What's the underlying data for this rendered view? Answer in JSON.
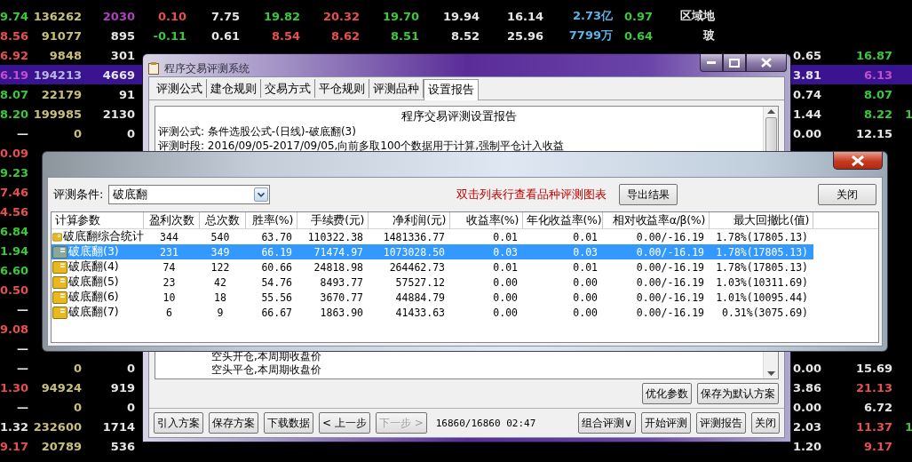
{
  "quotes": [
    {
      "selected": false,
      "left": [
        {
          "text": "9.74",
          "color": "#3cc83c"
        },
        {
          "text": "136262",
          "color": "#c8c07a"
        },
        {
          "text": "2030",
          "color": "#b040c0"
        }
      ],
      "mid": [
        {
          "text": "0.10",
          "color": "#e65050"
        },
        {
          "text": "7.75",
          "color": "#e6e6e6"
        },
        {
          "text": "19.82",
          "color": "#3cc83c"
        },
        {
          "text": "20.32",
          "color": "#e65050"
        },
        {
          "text": "19.70",
          "color": "#3cc83c"
        },
        {
          "text": "19.94",
          "color": "#e6e6e6"
        },
        {
          "text": "16.14",
          "color": "#e6e6e6"
        },
        {
          "text": "2.73亿",
          "color": "#5ab4e6"
        },
        {
          "text": "0.97",
          "color": "#3cc83c"
        },
        {
          "text": "区域地",
          "color": "#e6e6e6"
        }
      ]
    },
    {
      "selected": false,
      "left": [
        {
          "text": "8.56",
          "color": "#e65050"
        },
        {
          "text": "91077",
          "color": "#c8c07a"
        },
        {
          "text": "895",
          "color": "#e6e6e6"
        }
      ],
      "mid": [
        {
          "text": "-0.11",
          "color": "#3cc83c"
        },
        {
          "text": "0.61",
          "color": "#e6e6e6"
        },
        {
          "text": "8.54",
          "color": "#e65050"
        },
        {
          "text": "8.62",
          "color": "#e65050"
        },
        {
          "text": "8.51",
          "color": "#3cc83c"
        },
        {
          "text": "8.52",
          "color": "#e6e6e6"
        },
        {
          "text": "25.96",
          "color": "#e6e6e6"
        },
        {
          "text": "7799万",
          "color": "#5ab4e6"
        },
        {
          "text": "0.64",
          "color": "#3cc83c"
        },
        {
          "text": "玻",
          "color": "#e6e6e6"
        }
      ]
    },
    {
      "selected": false,
      "left": [
        {
          "text": "6.92",
          "color": "#e65050"
        },
        {
          "text": "9848",
          "color": "#c8c07a"
        },
        {
          "text": "301",
          "color": "#e6e6e6"
        }
      ],
      "right": [
        {
          "text": "0.65",
          "color": "#e6e6e6"
        },
        {
          "text": "16.87",
          "color": "#3cc83c"
        }
      ]
    },
    {
      "selected": true,
      "left": [
        {
          "text": "6.19",
          "color": "#c050d0"
        },
        {
          "text": "194213",
          "color": "#b8b8e0"
        },
        {
          "text": "4669",
          "color": "#e6e6e6"
        }
      ],
      "right": [
        {
          "text": "3.81",
          "color": "#e6e6e6"
        },
        {
          "text": "6.13",
          "color": "#c050d0"
        }
      ]
    },
    {
      "selected": false,
      "left": [
        {
          "text": "8.07",
          "color": "#3cc83c"
        },
        {
          "text": "22179",
          "color": "#c8c07a"
        },
        {
          "text": "91",
          "color": "#e6e6e6"
        }
      ],
      "right": [
        {
          "text": "0.74",
          "color": "#e6e6e6"
        },
        {
          "text": "8.07",
          "color": "#3cc83c"
        }
      ]
    },
    {
      "selected": false,
      "left": [
        {
          "text": "8.20",
          "color": "#3cc83c"
        },
        {
          "text": "199985",
          "color": "#c8c07a"
        },
        {
          "text": "2130",
          "color": "#e6e6e6"
        }
      ],
      "right": [
        {
          "text": "1.44",
          "color": "#e6e6e6"
        },
        {
          "text": "8.22",
          "color": "#3cc83c"
        },
        {
          "text": "1",
          "color": "#3cc83c"
        }
      ]
    },
    {
      "selected": false,
      "left": [
        {
          "text": "—",
          "color": "#e6e6e6"
        },
        {
          "text": "0",
          "color": "#c8c07a"
        },
        {
          "text": "0",
          "color": "#e6e6e6"
        }
      ],
      "right": [
        {
          "text": "0.00",
          "color": "#e6e6e6"
        },
        {
          "text": "12.15",
          "color": "#e6e6e6"
        }
      ]
    },
    {
      "selected": false,
      "left": [
        {
          "text": "0.09",
          "color": "#e65050"
        }
      ]
    },
    {
      "selected": false,
      "left": [
        {
          "text": "9.23",
          "color": "#3cc83c"
        }
      ]
    },
    {
      "selected": false,
      "left": [
        {
          "text": "7.46",
          "color": "#e65050"
        }
      ]
    },
    {
      "selected": false,
      "left": [
        {
          "text": "4.56",
          "color": "#e65050"
        }
      ]
    },
    {
      "selected": false,
      "left": [
        {
          "text": "6.84",
          "color": "#3cc83c"
        }
      ]
    },
    {
      "selected": false,
      "left": [
        {
          "text": "1.94",
          "color": "#3cc83c"
        }
      ]
    },
    {
      "selected": false,
      "left": [
        {
          "text": "6.60",
          "color": "#3cc83c"
        }
      ]
    },
    {
      "selected": false,
      "left": [
        {
          "text": "0.50",
          "color": "#e65050"
        }
      ]
    },
    {
      "selected": false,
      "left": [
        {
          "text": "—",
          "color": "#e6e6e6"
        }
      ]
    },
    {
      "selected": false,
      "left": [
        {
          "text": "9.08",
          "color": "#e65050"
        }
      ]
    },
    {
      "selected": false,
      "left": [
        {
          "text": "—",
          "color": "#e6e6e6"
        }
      ]
    },
    {
      "selected": false,
      "left": [
        {
          "text": "—",
          "color": "#e6e6e6"
        },
        {
          "text": "0",
          "color": "#c8c07a"
        },
        {
          "text": "0",
          "color": "#e6e6e6"
        }
      ],
      "right": [
        {
          "text": "0.00",
          "color": "#e6e6e6"
        },
        {
          "text": "15.69",
          "color": "#e6e6e6"
        }
      ]
    },
    {
      "selected": false,
      "left": [
        {
          "text": "1.30",
          "color": "#e65050"
        },
        {
          "text": "94924",
          "color": "#c8c07a"
        },
        {
          "text": "919",
          "color": "#e6e6e6"
        }
      ],
      "right": [
        {
          "text": "3.86",
          "color": "#e6e6e6"
        },
        {
          "text": "21.13",
          "color": "#e65050"
        }
      ]
    },
    {
      "selected": false,
      "left": [
        {
          "text": "—",
          "color": "#e6e6e6"
        },
        {
          "text": "0",
          "color": "#c8c07a"
        },
        {
          "text": "0",
          "color": "#e6e6e6"
        }
      ],
      "right": [
        {
          "text": "0.00",
          "color": "#e6e6e6"
        },
        {
          "text": "6.72",
          "color": "#e6e6e6"
        }
      ]
    },
    {
      "selected": false,
      "left": [
        {
          "text": "1.32",
          "color": "#e6e6e6"
        },
        {
          "text": "232600",
          "color": "#c8c07a"
        },
        {
          "text": "1714",
          "color": "#e6e6e6"
        }
      ],
      "right": [
        {
          "text": "2.03",
          "color": "#e6e6e6"
        },
        {
          "text": "11.37",
          "color": "#e65050"
        },
        {
          "text": "1",
          "color": "#3cc83c"
        }
      ]
    },
    {
      "selected": false,
      "left": [
        {
          "text": "9.17",
          "color": "#e65050"
        },
        {
          "text": "20789",
          "color": "#c8c07a"
        },
        {
          "text": "536",
          "color": "#e6e6e6"
        }
      ],
      "right": [
        {
          "text": "1.20",
          "color": "#e6e6e6"
        },
        {
          "text": "9.17",
          "color": "#e65050"
        }
      ]
    }
  ],
  "main_window": {
    "title": "程序交易评测系统",
    "tabs": [
      {
        "label": "评测公式",
        "selected": false
      },
      {
        "label": "建仓规则",
        "selected": false
      },
      {
        "label": "交易方式",
        "selected": false
      },
      {
        "label": "平仓规则",
        "selected": false
      },
      {
        "label": "评测品种",
        "selected": false
      },
      {
        "label": "设置报告",
        "selected": true
      }
    ],
    "report": {
      "heading": "程序交易评测设置报告",
      "lines": [
        "评测公式: 条件选股公式-(日线)-破底翻(3)",
        "评测时段: 2016/09/05-2017/09/05,向前多取100个数据用于计算,强制平仓计入收益"
      ],
      "tail_lines": [
        "空头开仓,本周期收盘价",
        "空头平仓,本周期收盘价"
      ]
    },
    "side_buttons": [
      "优化参数",
      "保存为默认方案"
    ],
    "footer_buttons": [
      {
        "label": "引入方案",
        "disabled": false
      },
      {
        "label": "保存方案",
        "disabled": false
      },
      {
        "label": "下载数据",
        "disabled": false
      },
      {
        "label": "< 上一步",
        "disabled": false
      },
      {
        "label": "下一步 >",
        "disabled": true
      }
    ],
    "status": "16860/16860 02:47",
    "footer_right": [
      "组合评测∨",
      "开始评测",
      "评测报告",
      "关闭"
    ]
  },
  "dialog": {
    "condition_label": "评测条件:",
    "condition_value": "破底翻",
    "hint": "双击列表行查看品种评测图表",
    "export_button": "导出结果",
    "close_button": "关闭",
    "columns": [
      "计算参数",
      "盈利次数",
      "总次数",
      "胜率(%)",
      "手续费(元)",
      "净利润(元)",
      "收益率(%)",
      "年化收益率(%)",
      "相对收益率α/β(%)",
      "最大回撤比(值)"
    ],
    "rows": [
      {
        "selected": false,
        "cells": [
          "破底翻综合统计",
          "344",
          "540",
          "63.70",
          "110322.38",
          "1481336.77",
          "0.01",
          "0.01",
          "0.00/-16.19",
          "1.78%(17805.13)"
        ]
      },
      {
        "selected": true,
        "cells": [
          "破底翻(3)",
          "231",
          "349",
          "66.19",
          "71474.97",
          "1073028.50",
          "0.03",
          "0.03",
          "0.00/-16.19",
          "1.78%(17805.13)"
        ]
      },
      {
        "selected": false,
        "cells": [
          "破底翻(4)",
          "74",
          "122",
          "60.66",
          "24818.98",
          "264462.73",
          "0.01",
          "0.01",
          "0.00/-16.19",
          "1.78%(17805.13)"
        ]
      },
      {
        "selected": false,
        "cells": [
          "破底翻(5)",
          "23",
          "42",
          "54.76",
          "8493.77",
          "57527.12",
          "0.00",
          "0.00",
          "0.00/-16.19",
          "1.03%(10311.69)"
        ]
      },
      {
        "selected": false,
        "cells": [
          "破底翻(6)",
          "10",
          "18",
          "55.56",
          "3670.77",
          "44884.79",
          "0.00",
          "0.00",
          "0.00/-16.19",
          "1.01%(10095.44)"
        ]
      },
      {
        "selected": false,
        "cells": [
          "破底翻(7)",
          "6",
          "9",
          "66.67",
          "1863.90",
          "41433.63",
          "0.00",
          "0.00",
          "0.00/-16.19",
          "0.31%(3075.69)"
        ]
      }
    ]
  }
}
